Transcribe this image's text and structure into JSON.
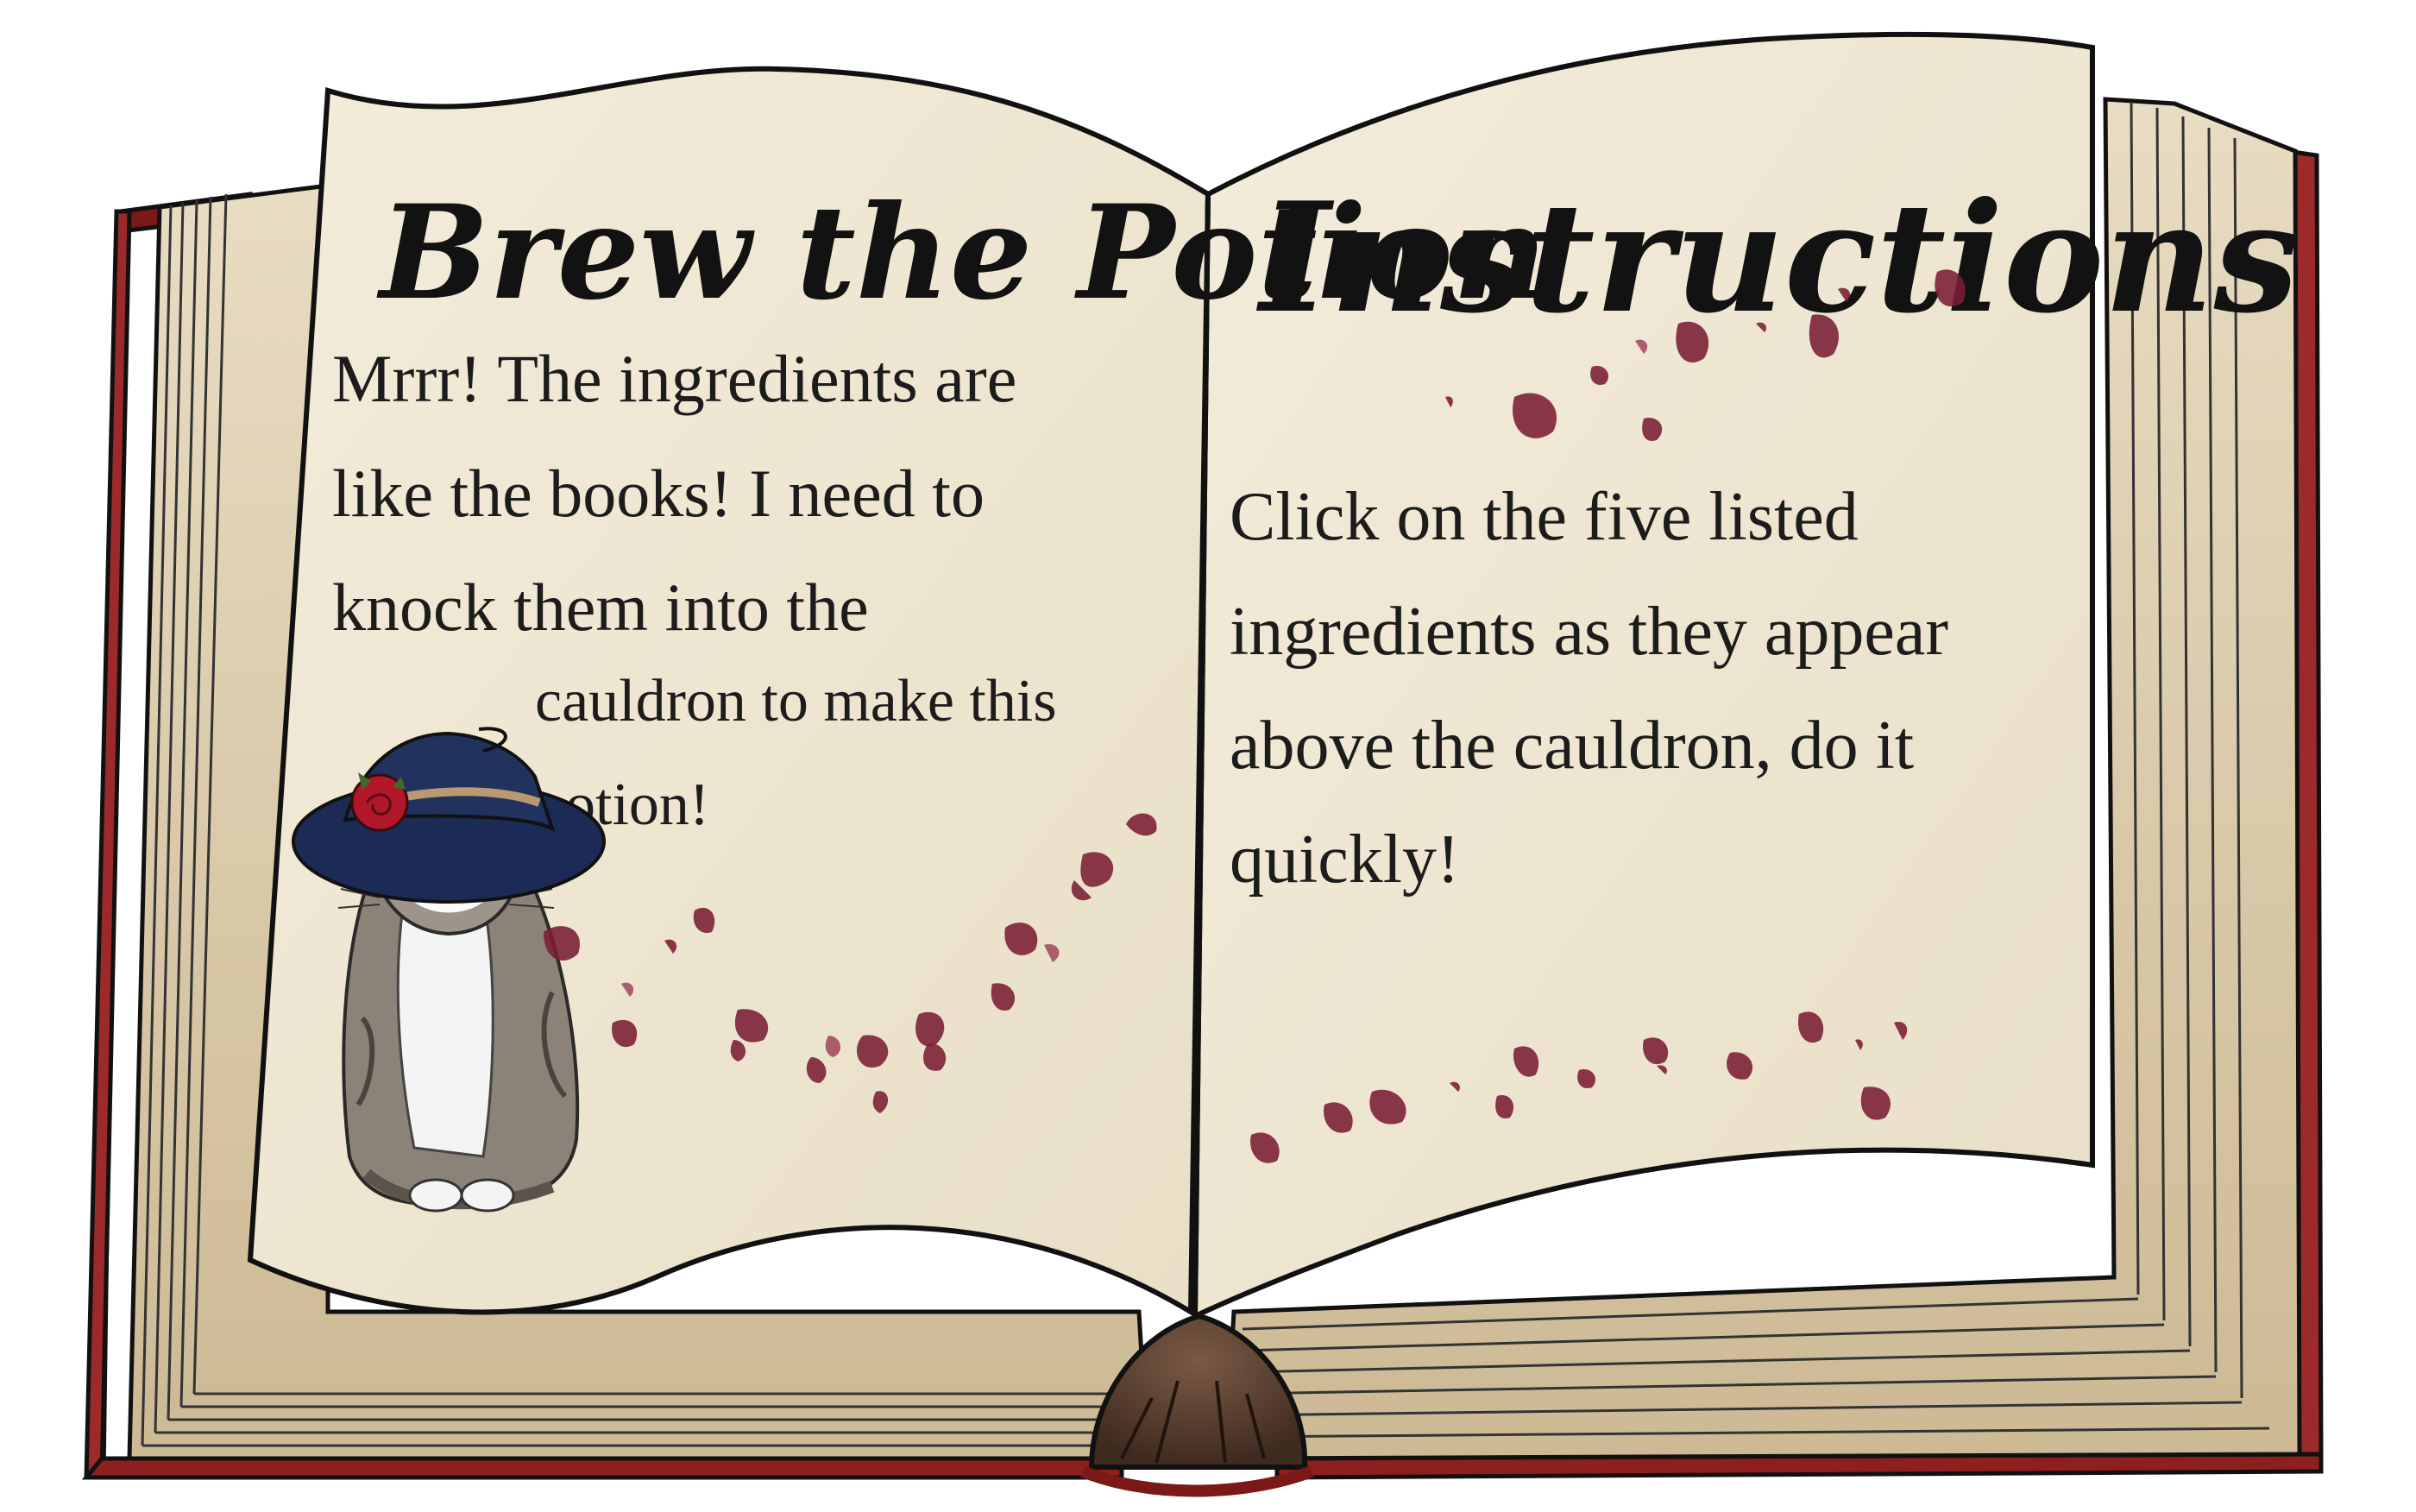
{
  "left_page": {
    "title": "Brew the Potion",
    "text_lines": [
      "Mrrr! The ingredients are",
      "like the books! I need to",
      "knock them into the",
      "cauldron to make this",
      "potion!"
    ]
  },
  "right_page": {
    "title": "Instructions",
    "text_lines": [
      "Click on the five listed",
      "ingredients as they appear",
      "above the cauldron, do it",
      "quickly!"
    ]
  },
  "colors": {
    "cover": "#8e1f1f",
    "page": "#efe6d2",
    "ink": "#111111",
    "petal": "#7a1c34",
    "hat": "#1b2b55"
  },
  "icons": {
    "mascot": "witch-cat-icon",
    "decoration": "rose-petal-icon"
  }
}
